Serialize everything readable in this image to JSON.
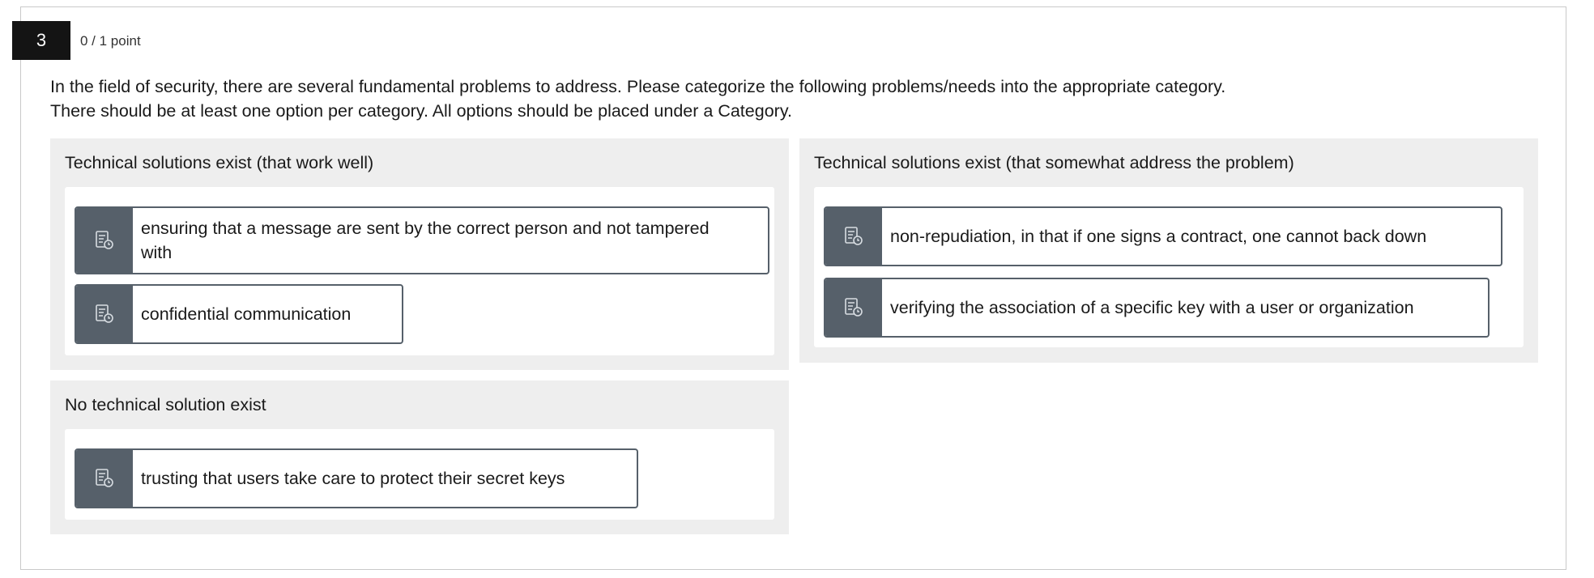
{
  "question": {
    "number": "3",
    "points": "0 / 1 point",
    "line1": "In the field of security, there are several fundamental problems to address. Please categorize the following problems/needs into the appropriate category.",
    "line2": "There should be at least one option per category. All options should be placed under a Category."
  },
  "categories": [
    {
      "title": "Technical solutions exist (that work well)",
      "items": [
        {
          "label": "ensuring that a message are sent by the correct person and not tampered with",
          "icon": "document-clock-icon"
        },
        {
          "label": "confidential communication",
          "icon": "document-clock-icon"
        }
      ]
    },
    {
      "title": "Technical solutions exist (that somewhat address the problem)",
      "items": [
        {
          "label": "non-repudiation, in that if one signs a contract, one cannot back down",
          "icon": "document-clock-icon"
        },
        {
          "label": "verifying the association of a specific key with a user or organization",
          "icon": "document-clock-icon"
        }
      ]
    },
    {
      "title": "No technical solution exist",
      "items": [
        {
          "label": "trusting that users take care to protect their secret keys",
          "icon": "document-clock-icon"
        }
      ]
    }
  ],
  "colors": {
    "handle": "#56606a",
    "category_bg": "#eeeeee",
    "number_badge": "#141414"
  }
}
